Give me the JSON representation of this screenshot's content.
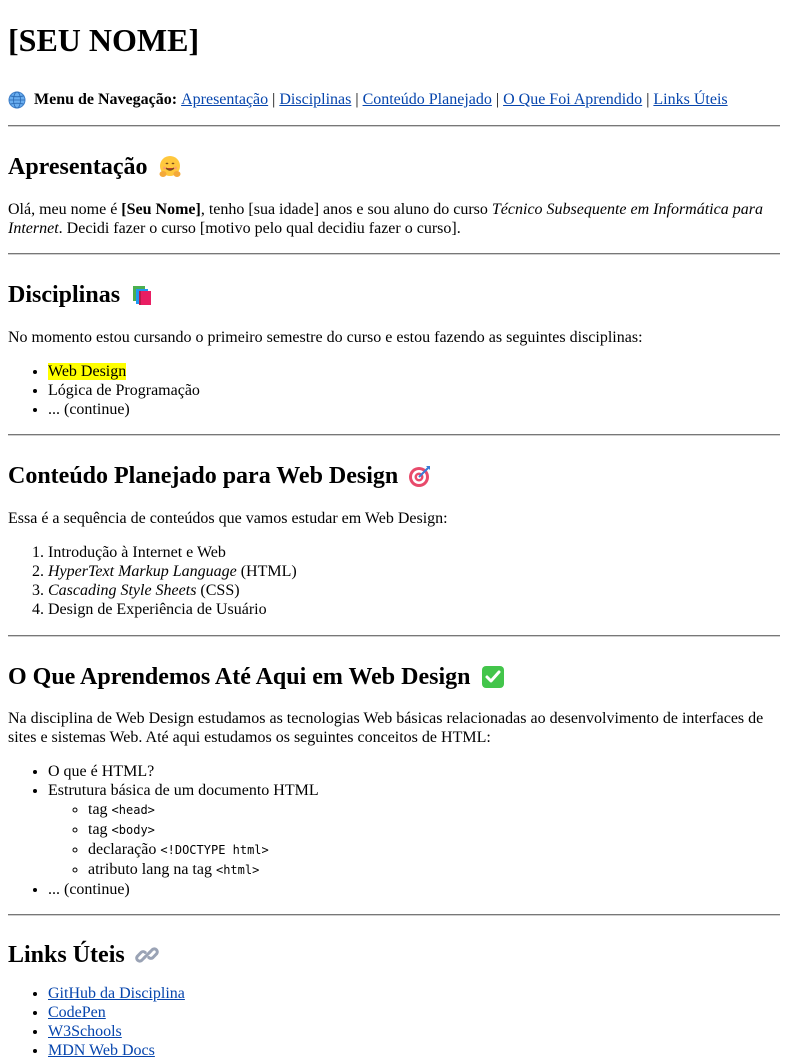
{
  "header": {
    "title": "[SEU NOME]"
  },
  "nav": {
    "icon": "globe-icon",
    "label": "Menu de Navegação:",
    "separator": "|",
    "links": [
      "Apresentação",
      "Disciplinas",
      "Conteúdo Planejado",
      "O Que Foi Aprendido",
      "Links Úteis"
    ]
  },
  "apresentacao": {
    "title": "Apresentação",
    "icon": "hugging-face-icon",
    "text_1": "Olá, meu nome é ",
    "name_bold": "[Seu Nome]",
    "text_2": ", tenho [sua idade] anos e sou aluno do curso ",
    "course_italic": "Técnico Subsequente em Informática para Internet",
    "text_3": ". Decidi fazer o curso [motivo pelo qual decidiu fazer o curso]."
  },
  "disciplinas": {
    "title": "Disciplinas",
    "icon": "books-icon",
    "intro": "No momento estou cursando o primeiro semestre do curso e estou fazendo as seguintes disciplinas:",
    "items": [
      "Web Design",
      "Lógica de Programação",
      "... (continue)"
    ]
  },
  "conteudo": {
    "title": "Conteúdo Planejado para Web Design",
    "icon": "target-icon",
    "intro": "Essa é a sequência de conteúdos que vamos estudar em Web Design:",
    "item_1": "Introdução à Internet e Web",
    "item_2_italic": "HyperText Markup Language",
    "item_2_rest": " (HTML)",
    "item_3_italic": "Cascading Style Sheets",
    "item_3_rest": " (CSS)",
    "item_4": "Design de Experiência de Usuário"
  },
  "aprendido": {
    "title": "O Que Aprendemos Até Aqui em Web Design",
    "icon": "check-mark-icon",
    "intro": "Na disciplina de Web Design estudamos as tecnologias Web básicas relacionadas ao desenvolvimento de interfaces de sites e sistemas Web. Até aqui estudamos os seguintes conceitos de HTML:",
    "item_1": "O que é HTML?",
    "item_2": "Estrutura básica de um documento HTML",
    "sub": [
      {
        "text": "tag ",
        "code": "<head>"
      },
      {
        "text": "tag ",
        "code": "<body>"
      },
      {
        "text": "declaração ",
        "code": "<!DOCTYPE html>"
      },
      {
        "text": "atributo lang na tag ",
        "code": "<html>"
      }
    ],
    "item_3": "... (continue)"
  },
  "links": {
    "title": "Links Úteis",
    "icon": "link-icon",
    "items": [
      "GitHub da Disciplina",
      "CodePen",
      "W3Schools",
      "MDN Web Docs"
    ]
  },
  "colors": {
    "link": "#0645ad",
    "highlight": "#ffff00"
  }
}
